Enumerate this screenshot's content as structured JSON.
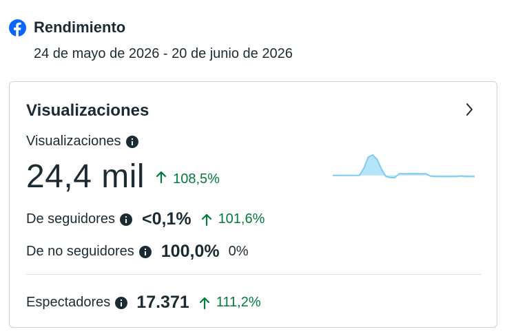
{
  "header": {
    "title": "Rendimiento",
    "date_range": "24 de mayo de 2026 - 20 de junio de 2026"
  },
  "card": {
    "title": "Visualizaciones",
    "views": {
      "label": "Visualizaciones",
      "value": "24,4 mil",
      "change": "108,5%",
      "trend_series": [
        1,
        1,
        1,
        1,
        1,
        1,
        1,
        2.2,
        4.2,
        4.6,
        3.8,
        2.1,
        0.8,
        0.6,
        0.6,
        1.3,
        1.3,
        1.3,
        1.3,
        1.3,
        1.3,
        1.3,
        0.9,
        0.8,
        0.8,
        0.8,
        0.8,
        0.8,
        0.8,
        0.9,
        0.8,
        0.8,
        0.8
      ]
    },
    "followers": {
      "label": "De seguidores",
      "value": "<0,1%",
      "change": "101,6%"
    },
    "non_followers": {
      "label": "De no seguidores",
      "value": "100,0%",
      "change": "0%"
    },
    "viewers": {
      "label": "Espectadores",
      "value": "17.371",
      "change": "111,2%"
    }
  },
  "colors": {
    "brand": "#0866ff",
    "positive": "#007a3d",
    "spark_line": "#79cdf2",
    "spark_fill": "#b6e4f8"
  }
}
